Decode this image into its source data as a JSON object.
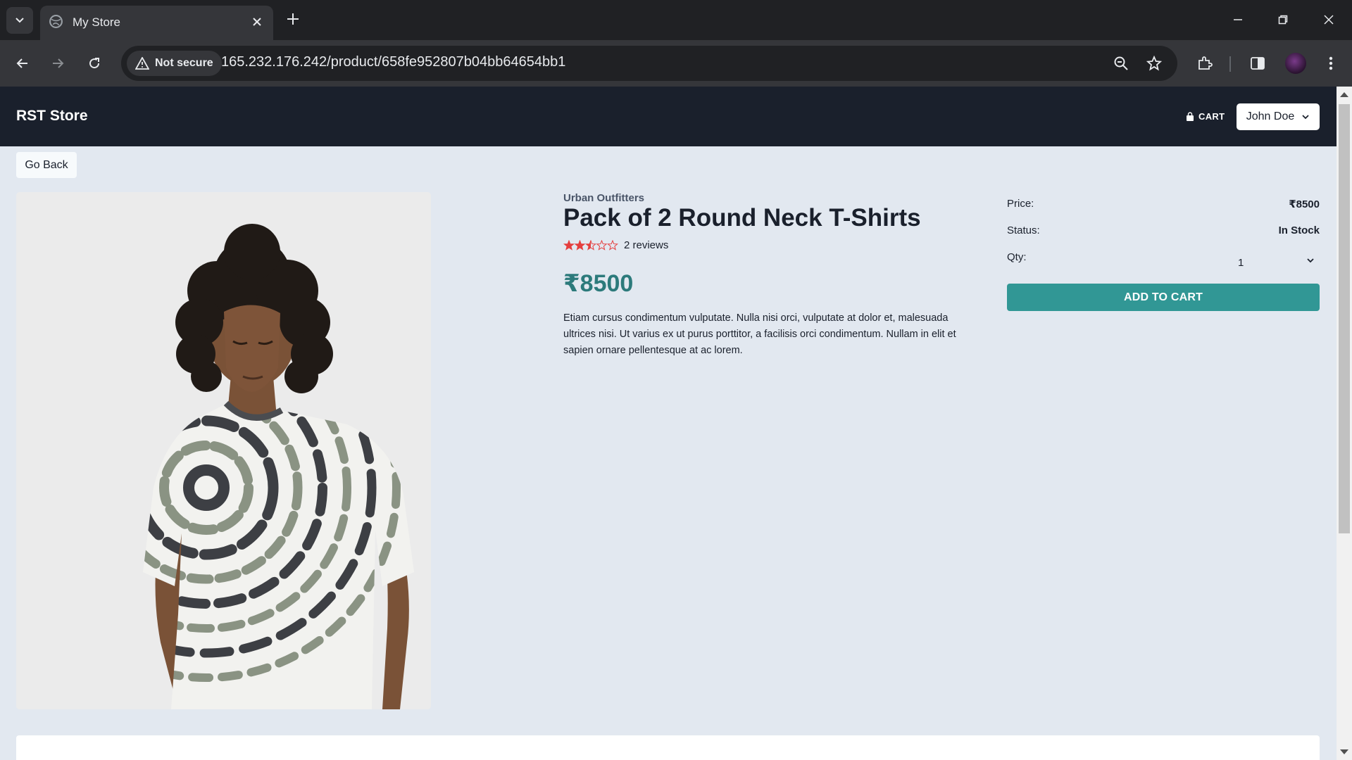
{
  "browser": {
    "tab_title": "My Store",
    "url": "165.232.176.242/product/658fe952807b04bb64654bb1",
    "security_label": "Not secure"
  },
  "header": {
    "brand": "RST Store",
    "cart_label": "CART",
    "user_name": "John Doe"
  },
  "page": {
    "go_back": "Go Back"
  },
  "product": {
    "brand": "Urban Outfitters",
    "title": "Pack of 2 Round Neck T-Shirts",
    "rating": 2.5,
    "rating_max": 5,
    "reviews_text": "2 reviews",
    "price": "₹8500",
    "description": "Etiam cursus condimentum vulputate. Nulla nisi orci, vulputate at dolor et, malesuada ultrices nisi. Ut varius ex ut purus porttitor, a facilisis orci condimentum. Nullam in elit et sapien ornare pellentesque at ac lorem."
  },
  "buy_panel": {
    "price_label": "Price:",
    "price_value": "₹8500",
    "status_label": "Status:",
    "status_value": "In Stock",
    "qty_label": "Qty:",
    "qty_value": "1",
    "add_to_cart": "ADD TO CART"
  },
  "colors": {
    "header_bg": "#1a202c",
    "accent": "#319795",
    "price_text": "#2c7a7b",
    "star": "#e53e3e",
    "page_bg": "#e2e8f0"
  }
}
